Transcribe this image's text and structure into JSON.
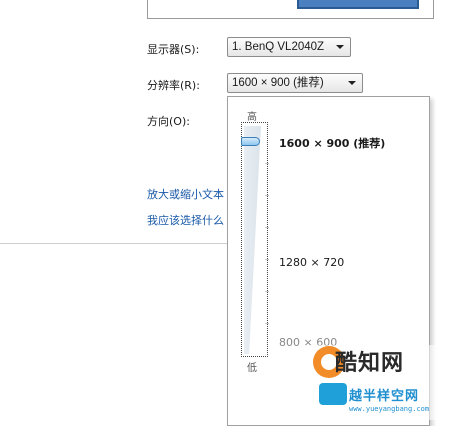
{
  "display": {
    "monitor_label": "显示器(S):",
    "monitor_value": "1. BenQ VL2040Z",
    "resolution_label": "分辨率(R):",
    "resolution_value": "1600 × 900 (推荐)",
    "orientation_label": "方向(O):"
  },
  "links": {
    "enlarge_text": "放大或缩小文本",
    "which_settings": "我应该选择什么"
  },
  "resolution_dropdown": {
    "scale_high": "高",
    "scale_low": "低",
    "options": [
      {
        "label": "1600 × 900 (推荐)",
        "selected": true
      },
      {
        "label": "1280 × 720",
        "selected": false
      },
      {
        "label": "800 × 600",
        "selected": false
      }
    ],
    "slider_level": 1.0
  },
  "watermark": {
    "title": "酷知网",
    "subtitle": "越半样空网",
    "url": "www.yueyangbang.com"
  },
  "colors": {
    "link": "#1a5aa8",
    "thumb": "#8fc6ee",
    "watermark_orange": "#f28c28",
    "watermark_blue": "#1f8fd0"
  }
}
